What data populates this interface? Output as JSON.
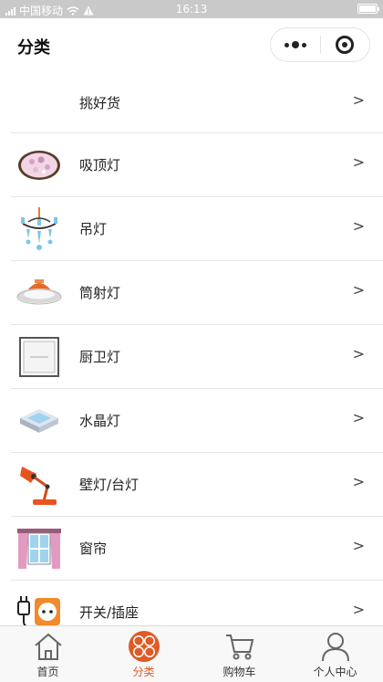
{
  "status_bar": {
    "carrier": "中国移动",
    "time": "16:13"
  },
  "header": {
    "title": "分类"
  },
  "categories": [
    {
      "label": "挑好货",
      "chevron": ">",
      "icon": ""
    },
    {
      "label": "吸顶灯",
      "chevron": ">",
      "icon": "ceiling-lamp-icon"
    },
    {
      "label": "吊灯",
      "chevron": ">",
      "icon": "chandelier-icon"
    },
    {
      "label": "筒射灯",
      "chevron": ">",
      "icon": "downlight-icon"
    },
    {
      "label": "厨卫灯",
      "chevron": ">",
      "icon": "kitchen-bath-lamp-icon"
    },
    {
      "label": "水晶灯",
      "chevron": ">",
      "icon": "crystal-lamp-icon"
    },
    {
      "label": "壁灯/台灯",
      "chevron": ">",
      "icon": "desk-lamp-icon"
    },
    {
      "label": "窗帘",
      "chevron": ">",
      "icon": "curtain-icon"
    },
    {
      "label": "开关/插座",
      "chevron": ">",
      "icon": "switch-socket-icon"
    }
  ],
  "tabs": [
    {
      "label": "首页",
      "icon": "home-icon",
      "active": false
    },
    {
      "label": "分类",
      "icon": "category-icon",
      "active": true
    },
    {
      "label": "购物车",
      "icon": "cart-icon",
      "active": false
    },
    {
      "label": "个人中心",
      "icon": "user-icon",
      "active": false
    }
  ],
  "colors": {
    "accent": "#e05a25",
    "status_bar": "#c9c9c9",
    "divider": "#e6e6e6"
  }
}
